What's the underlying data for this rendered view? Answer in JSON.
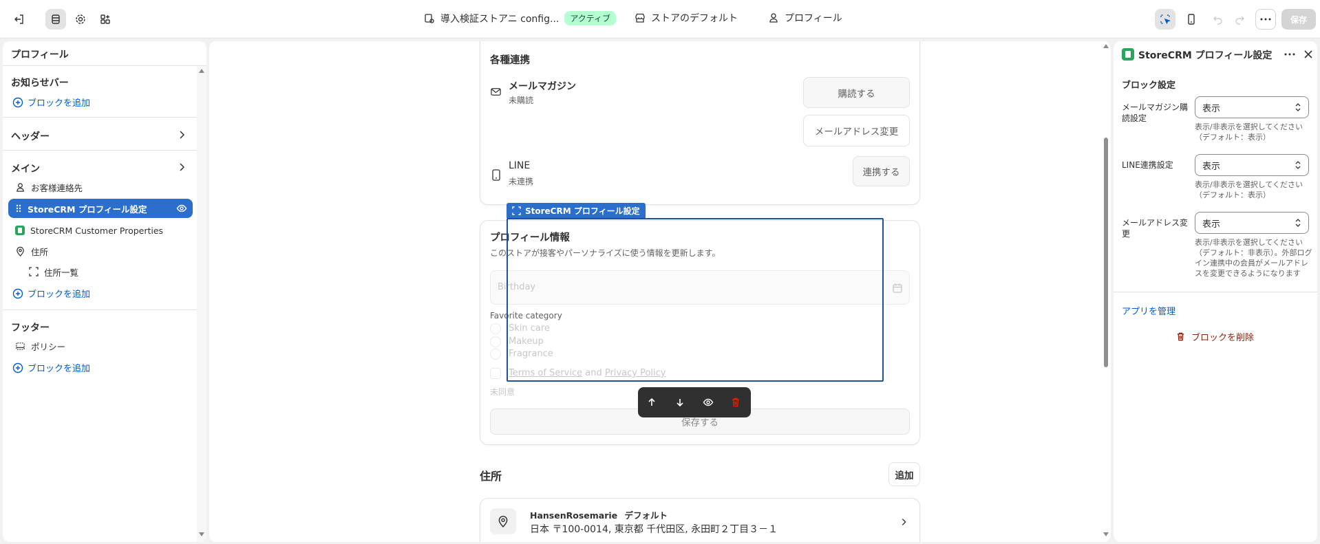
{
  "topbar": {
    "store_name": "導入検証ストアニ config...",
    "status_badge": "アクティブ",
    "theme_default": "ストアのデフォルト",
    "page_name": "プロフィール",
    "save_label": "保存"
  },
  "sidebar": {
    "title": "プロフィール",
    "announcement_section": "お知らせバー",
    "add_block": "ブロックを追加",
    "header_section": "ヘッダー",
    "main_section": "メイン",
    "items": [
      {
        "label": "お客様連絡先"
      },
      {
        "label": "StoreCRM プロフィール設定"
      },
      {
        "label": "StoreCRM Customer Properties"
      },
      {
        "label": "住所"
      },
      {
        "label": "住所一覧"
      }
    ],
    "footer_section": "フッター",
    "footer_item": "ポリシー"
  },
  "preview": {
    "integrations": {
      "title": "各種連携",
      "mail": {
        "title": "メールマガジン",
        "status": "未購読",
        "subscribe": "購読する",
        "change_email": "メールアドレス変更"
      },
      "line": {
        "title": "LINE",
        "status": "未連携",
        "connect": "連携する"
      }
    },
    "block_tag": "StoreCRM プロフィール設定",
    "profile": {
      "title": "プロフィール情報",
      "subtitle": "このストアが接客やパーソナライズに使う情報を更新します。",
      "birthday_placeholder": "Birthday",
      "category_label": "Favorite category",
      "options": [
        "Skin care",
        "Makeup",
        "Fragrance"
      ],
      "terms_link": "Terms of Service",
      "and_text": "and",
      "privacy_link": "Privacy Policy",
      "consent_status": "未同意",
      "save": "保存する"
    },
    "address": {
      "title": "住所",
      "add": "追加",
      "name": "HansenRosemarie",
      "default_tag": "デフォルト",
      "line": "日本 〒100-0014, 東京都 千代田区, 永田町２丁目３－１"
    }
  },
  "rpanel": {
    "title": "StoreCRM プロフィール設定",
    "section": "ブロック設定",
    "fields": [
      {
        "label": "メールマガジン購読設定",
        "value": "表示",
        "help": "表示/非表示を選択してください（デフォルト：表示）"
      },
      {
        "label": "LINE連携設定",
        "value": "表示",
        "help": "表示/非表示を選択してください（デフォルト：表示）"
      },
      {
        "label": "メールアドレス変更",
        "value": "表示",
        "help": "表示/非表示を選択してください（デフォルト：非表示）。外部ログイン連携中の会員がメールアドレスを変更できるようになります"
      }
    ],
    "manage_app": "アプリを管理",
    "delete_block": "ブロックを削除"
  },
  "colors": {
    "accent": "#005bd3",
    "active": "#2c6ecb",
    "badge_bg": "#b4fed2",
    "danger": "#8e1f0b",
    "app_icon": "#29a55c"
  }
}
